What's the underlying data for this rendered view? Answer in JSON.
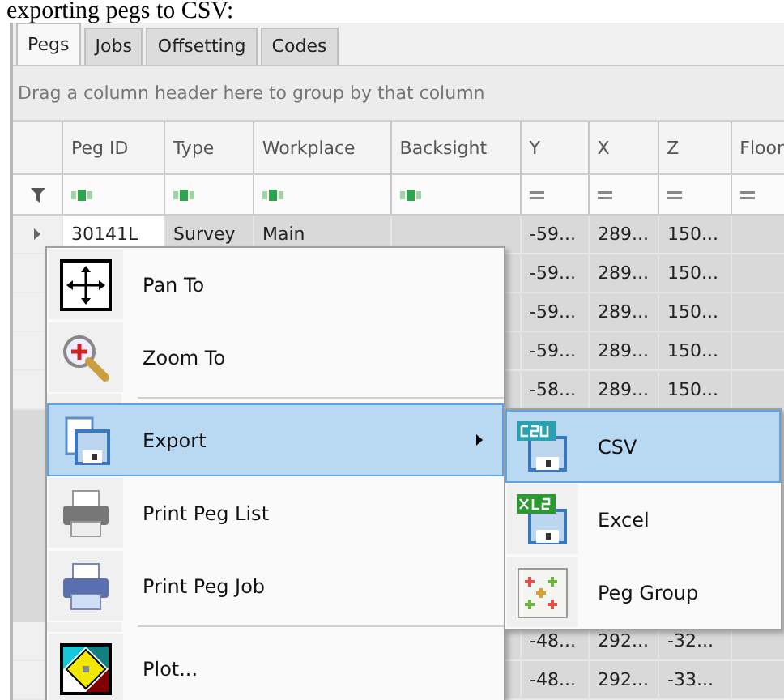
{
  "caption": "exporting pegs to CSV:",
  "tabs": [
    {
      "label": "Pegs",
      "selected": true
    },
    {
      "label": "Jobs",
      "selected": false
    },
    {
      "label": "Offsetting",
      "selected": false
    },
    {
      "label": "Codes",
      "selected": false
    }
  ],
  "group_panel": {
    "placeholder": "Drag a column header here to group by that column"
  },
  "table": {
    "columns": [
      {
        "label": "Peg ID",
        "kind": "text"
      },
      {
        "label": "Type",
        "kind": "text"
      },
      {
        "label": "Workplace",
        "kind": "text"
      },
      {
        "label": "Backsight",
        "kind": "text"
      },
      {
        "label": "Y",
        "kind": "number"
      },
      {
        "label": "X",
        "kind": "number"
      },
      {
        "label": "Z",
        "kind": "number"
      },
      {
        "label": "Floor",
        "kind": "number"
      }
    ],
    "rows": [
      {
        "current": true,
        "cells": [
          "30141L",
          "Survey",
          "Main",
          "",
          "-59...",
          "289...",
          "150...",
          ""
        ]
      },
      {
        "current": false,
        "cells": [
          "",
          "",
          "",
          "",
          "-59...",
          "289...",
          "150...",
          ""
        ]
      },
      {
        "current": false,
        "cells": [
          "",
          "",
          "",
          "",
          "-59...",
          "289...",
          "150...",
          ""
        ]
      },
      {
        "current": false,
        "cells": [
          "",
          "",
          "",
          "",
          "-59...",
          "289...",
          "150...",
          ""
        ]
      },
      {
        "current": false,
        "cells": [
          "",
          "",
          "",
          "",
          "-58...",
          "289...",
          "150...",
          ""
        ]
      }
    ],
    "lower_rows": [
      {
        "current": false,
        "cells": [
          "",
          "",
          "",
          "",
          "-48...",
          "292...",
          "-32...",
          ""
        ]
      },
      {
        "current": false,
        "cells": [
          "",
          "",
          "",
          "",
          "-48...",
          "292...",
          "-33...",
          ""
        ]
      }
    ]
  },
  "context_menu": {
    "items": [
      {
        "label": "Pan To",
        "separator_before": false,
        "has_submenu": false,
        "selected": false
      },
      {
        "label": "Zoom To",
        "separator_before": false,
        "has_submenu": false,
        "selected": false
      },
      {
        "label": "Export",
        "separator_before": true,
        "has_submenu": true,
        "selected": true
      },
      {
        "label": "Print Peg List",
        "separator_before": false,
        "has_submenu": false,
        "selected": false
      },
      {
        "label": "Print Peg Job",
        "separator_before": false,
        "has_submenu": false,
        "selected": false
      },
      {
        "label": "Plot...",
        "separator_before": true,
        "has_submenu": false,
        "selected": false
      }
    ]
  },
  "submenu": {
    "items": [
      {
        "label": "CSV",
        "selected": true
      },
      {
        "label": "Excel",
        "selected": false
      },
      {
        "label": "Peg Group",
        "selected": false
      }
    ]
  }
}
